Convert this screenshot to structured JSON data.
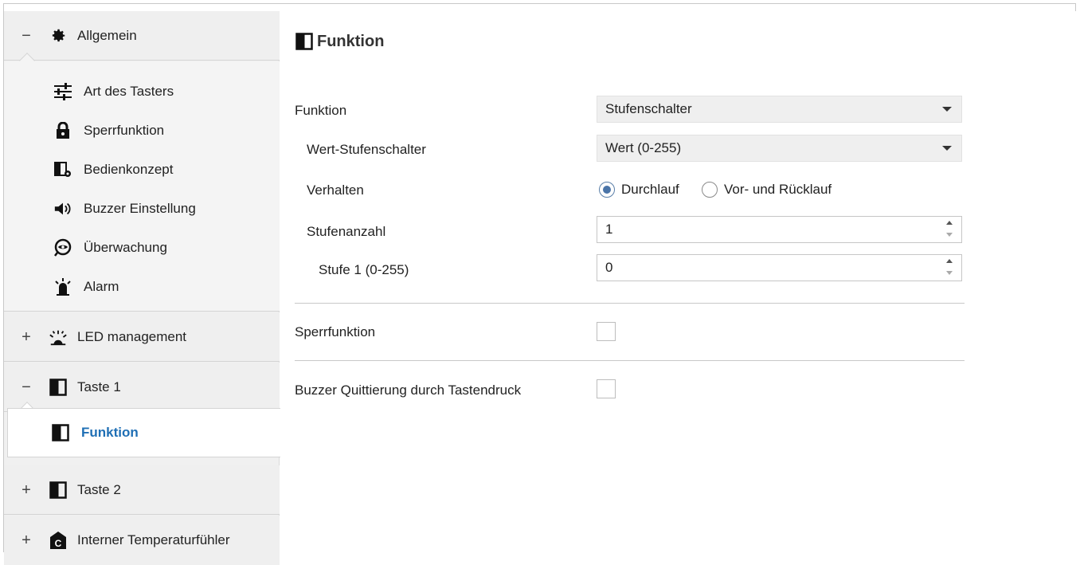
{
  "sidebar": {
    "allgemein": {
      "toggle": "−",
      "label": "Allgemein",
      "icon": "gear-icon"
    },
    "allgemein_items": [
      {
        "label": "Art des Tasters",
        "icon": "sliders-icon"
      },
      {
        "label": "Sperrfunktion",
        "icon": "lock-icon"
      },
      {
        "label": "Bedienkonzept",
        "icon": "panel-gear-icon"
      },
      {
        "label": "Buzzer Einstellung",
        "icon": "speaker-icon"
      },
      {
        "label": "Überwachung",
        "icon": "eye-icon"
      },
      {
        "label": "Alarm",
        "icon": "alarm-bell-icon"
      }
    ],
    "led": {
      "toggle": "+",
      "label": "LED management",
      "icon": "led-icon"
    },
    "taste1": {
      "toggle": "−",
      "label": "Taste 1",
      "icon": "half-square-icon"
    },
    "taste1_items": [
      {
        "label": "Funktion",
        "icon": "half-square-icon",
        "active": true
      }
    ],
    "taste2": {
      "toggle": "+",
      "label": "Taste 2",
      "icon": "half-square-icon"
    },
    "temp": {
      "toggle": "+",
      "label": "Interner Temperaturfühler",
      "icon": "thermometer-c-icon"
    }
  },
  "main": {
    "title": "Funktion",
    "funktion": {
      "label": "Funktion",
      "value": "Stufenschalter"
    },
    "wert": {
      "label": "Wert-Stufenschalter",
      "value": "Wert (0-255)"
    },
    "verhalten": {
      "label": "Verhalten",
      "options": [
        "Durchlauf",
        "Vor- und Rücklauf"
      ],
      "selected": "Durchlauf"
    },
    "stufenanzahl": {
      "label": "Stufenanzahl",
      "value": "1"
    },
    "stufe1": {
      "label": "Stufe 1 (0-255)",
      "value": "0"
    },
    "sperrfunktion": {
      "label": "Sperrfunktion",
      "checked": false
    },
    "buzzer": {
      "label": "Buzzer Quittierung durch Tastendruck",
      "checked": false
    }
  },
  "colors": {
    "active_link": "#1f6fb5",
    "sidebar_bg": "#efefef",
    "radio_on": "#4a74a8"
  }
}
